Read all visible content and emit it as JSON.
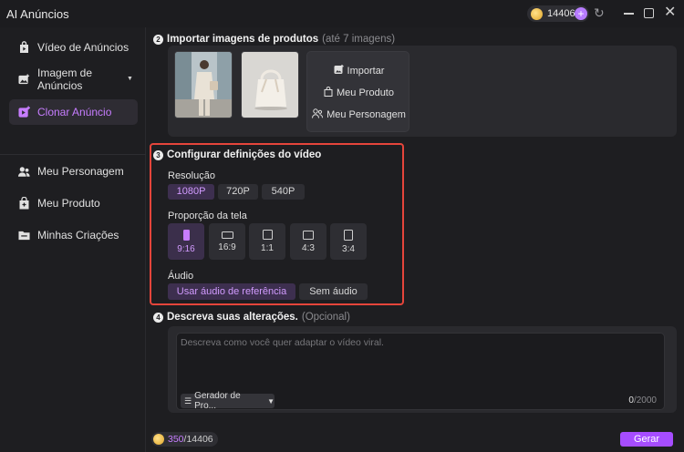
{
  "app": {
    "title": "AI Anúncios",
    "credits": "14406"
  },
  "sidebar": {
    "items": [
      {
        "label": "Vídeo de Anúncios",
        "icon": "video-bag-icon",
        "active": false
      },
      {
        "label": "Imagem de Anúncios",
        "icon": "image-icon",
        "active": false
      },
      {
        "label": "Clonar Anúncio",
        "icon": "clone-icon",
        "active": true
      },
      {
        "label": "Meu Personagem",
        "icon": "person-icon",
        "active": false
      },
      {
        "label": "Meu Produto",
        "icon": "product-bag-icon",
        "active": false
      },
      {
        "label": "Minhas Criações",
        "icon": "folder-icon",
        "active": false
      }
    ]
  },
  "import": {
    "step": "2",
    "title": "Importar imagens de produtos",
    "hint": "(até 7 imagens)",
    "actions": {
      "import": "Importar",
      "product": "Meu Produto",
      "persona": "Meu Personagem"
    }
  },
  "config": {
    "step": "3",
    "title": "Configurar definições do vídeo",
    "resolution_label": "Resolução",
    "resolutions": [
      "1080P",
      "720P",
      "540P"
    ],
    "selected_resolution": "1080P",
    "ratio_label": "Proporção da tela",
    "ratios": [
      "9:16",
      "16:9",
      "1:1",
      "4:3",
      "3:4"
    ],
    "selected_ratio": "9:16",
    "audio_label": "Áudio",
    "audio_options": [
      "Usar áudio de referência",
      "Sem áudio"
    ],
    "selected_audio": "Usar áudio de referência"
  },
  "describe": {
    "step": "4",
    "title": "Descreva suas alterações.",
    "optional": "(Opcional)",
    "placeholder": "Descreva como você quer adaptar o vídeo viral.",
    "generator": "Gerador de Pro...",
    "count_current": "0",
    "count_max": "/2000"
  },
  "footer": {
    "cost_used": "350",
    "cost_total": "/14406",
    "generate": "Gerar"
  },
  "colors": {
    "accent": "#c77dff",
    "button": "#a64dff",
    "highlight_border": "#e5453b"
  }
}
